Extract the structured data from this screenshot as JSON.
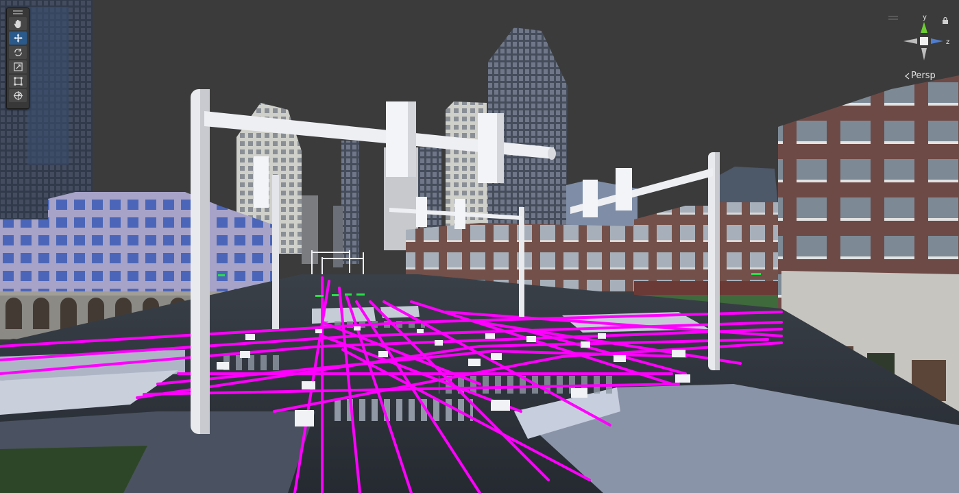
{
  "scene_view": {
    "camera_mode_label": "Persp",
    "axes": {
      "y_label": "y",
      "z_label": "z"
    }
  },
  "toolbox": {
    "tools": [
      {
        "name": "hand-tool",
        "icon": "hand-icon",
        "active": false
      },
      {
        "name": "move-tool",
        "icon": "move-arrows-icon",
        "active": true
      },
      {
        "name": "rotate-tool",
        "icon": "rotate-icon",
        "active": false
      },
      {
        "name": "scale-tool",
        "icon": "scale-icon",
        "active": false
      },
      {
        "name": "rect-tool",
        "icon": "rect-transform-icon",
        "active": false
      },
      {
        "name": "transform-tool",
        "icon": "transform-icon",
        "active": false
      }
    ]
  },
  "colors": {
    "sky": "#3b3b3b",
    "lane_lines": "#ff00ff",
    "asphalt": "#2b313a",
    "poles": "#f2f3f6",
    "gizmo_y": "#6ccc32",
    "gizmo_z": "#4f7ecf",
    "active_tool": "#2a5a8c"
  }
}
